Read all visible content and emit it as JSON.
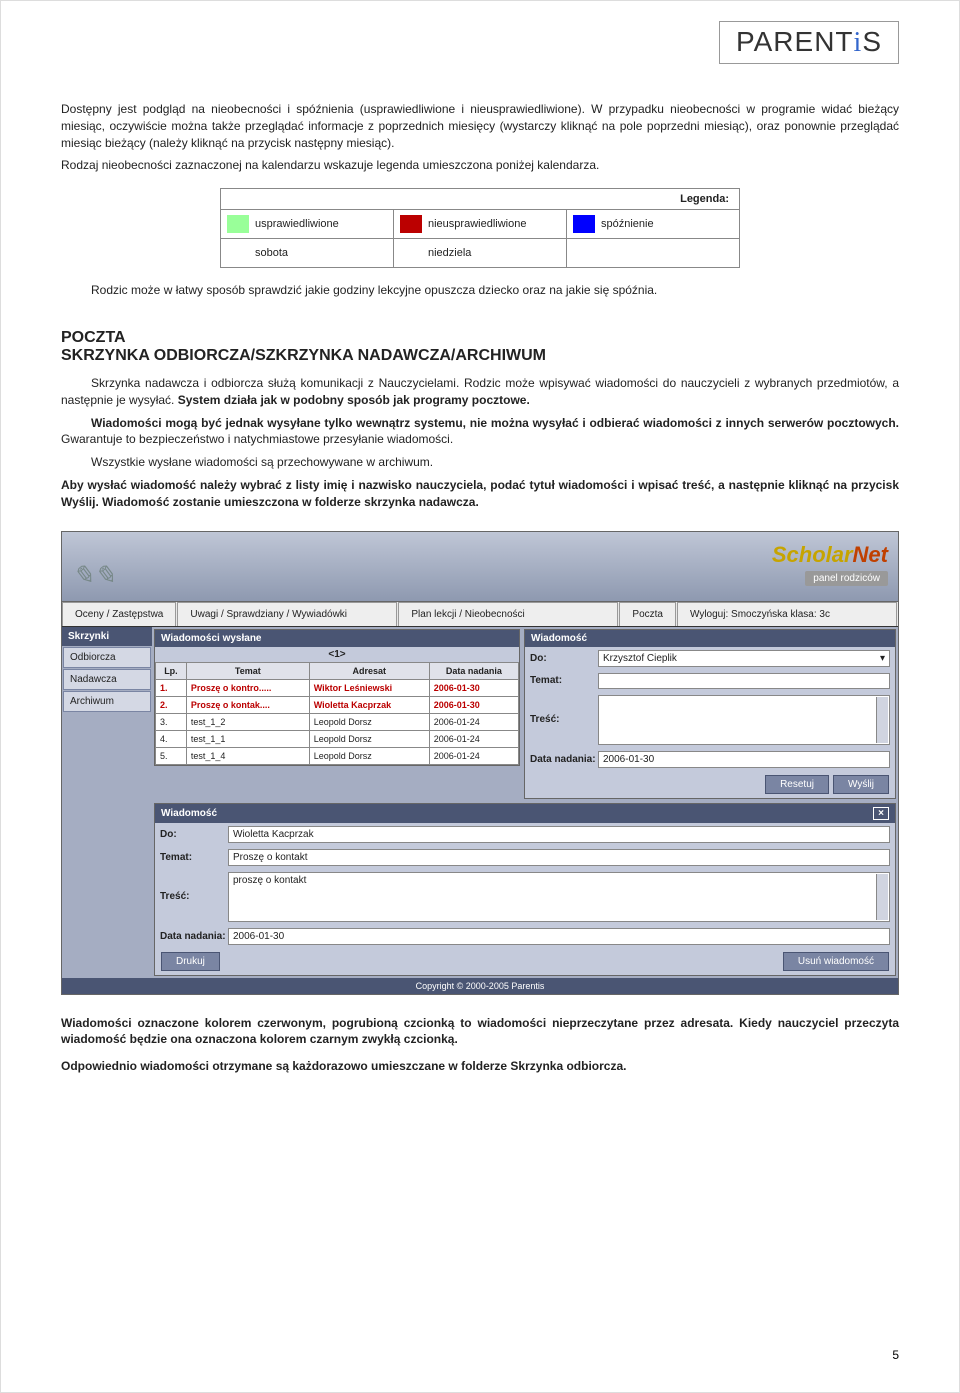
{
  "brand": "PARENTiS",
  "intro_p1": "Dostępny jest podgląd na nieobecności i spóźnienia (usprawiedliwione i nieusprawiedliwione). W przypadku nieobecności w programie widać bieżący miesiąc, oczywiście można także przeglądać informacje z poprzednich miesięcy (wystarczy kliknąć na pole poprzedni miesiąc), oraz ponownie przeglądać miesiąc bieżący (należy kliknąć na przycisk następny miesiąc).",
  "intro_p2": "Rodzaj nieobecności zaznaczonej na kalendarzu wskazuje legenda umieszczona poniżej kalendarza.",
  "legend": {
    "title": "Legenda:",
    "r1c1": "usprawiedliwione",
    "r1c2": "nieusprawiedliwione",
    "r1c3": "spóźnienie",
    "r2c1": "sobota",
    "r2c2": "niedziela"
  },
  "intro_p3": "Rodzic może w łatwy sposób sprawdzić jakie godziny lekcyjne opuszcza dziecko oraz na jakie się spóźnia.",
  "section_title": "POCZTA\nSKRZYNKA ODBIORCZA/SZKRZYNKA NADAWCZA/ARCHIWUM",
  "p4a": "Skrzynka nadawcza i odbiorcza służą komunikacji z Nauczycielami. Rodzic może wpisywać wiadomości do nauczycieli z wybranych przedmiotów, a następnie je wysyłać. ",
  "p4b": "System działa jak w podobny sposób jak programy pocztowe.",
  "p5a": "Wiadomości mogą być jednak wysyłane tylko wewnątrz systemu, nie można wysyłać i odbierać wiadomości z innych serwerów pocztowych.",
  "p5b": " Gwarantuje to bezpieczeństwo i natychmiastowe przesyłanie wiadomości.",
  "p6": "Wszystkie wysłane wiadomości są przechowywane w archiwum.",
  "p7": "Aby wysłać wiadomość należy wybrać z listy imię i nazwisko nauczyciela, podać tytuł wiadomości i wpisać treść, a następnie kliknąć na przycisk Wyślij. Wiadomość zostanie umieszczona w folderze skrzynka nadawcza.",
  "app": {
    "logo": "ScholarNet",
    "panel_tag": "panel rodziców",
    "tabs": {
      "t1": "Oceny / Zastępstwa",
      "t2": "Uwagi / Sprawdziany / Wywiadówki",
      "t3": "Plan lekcji / Nieobecności",
      "t4": "Poczta",
      "t5": "Wyloguj: Smoczyńska klasa: 3c"
    },
    "sidebar": {
      "head": "Skrzynki",
      "items": [
        "Odbiorcza",
        "Nadawcza",
        "Archiwum"
      ]
    },
    "sent_panel": {
      "title": "Wiadomości wysłane",
      "pager": "<1>",
      "cols": {
        "lp": "Lp.",
        "temat": "Temat",
        "adresat": "Adresat",
        "data": "Data nadania"
      },
      "rows": [
        {
          "lp": "1.",
          "temat": "Proszę o kontro.....",
          "adresat": "Wiktor Leśniewski",
          "data": "2006-01-30",
          "unread": true
        },
        {
          "lp": "2.",
          "temat": "Proszę o kontak....",
          "adresat": "Wioletta Kacprzak",
          "data": "2006-01-30",
          "unread": true
        },
        {
          "lp": "3.",
          "temat": "test_1_2",
          "adresat": "Leopold Dorsz",
          "data": "2006-01-24",
          "unread": false
        },
        {
          "lp": "4.",
          "temat": "test_1_1",
          "adresat": "Leopold Dorsz",
          "data": "2006-01-24",
          "unread": false
        },
        {
          "lp": "5.",
          "temat": "test_1_4",
          "adresat": "Leopold Dorsz",
          "data": "2006-01-24",
          "unread": false
        }
      ]
    },
    "compose": {
      "title": "Wiadomość",
      "do_label": "Do:",
      "do_value": "Krzysztof Cieplik",
      "temat_label": "Temat:",
      "tresc_label": "Treść:",
      "data_label": "Data nadania:",
      "data_value": "2006-01-30",
      "btn_reset": "Resetuj",
      "btn_send": "Wyślij"
    },
    "view": {
      "title": "Wiadomość",
      "close": "×",
      "do_label": "Do:",
      "do_value": "Wioletta Kacprzak",
      "temat_label": "Temat:",
      "temat_value": "Proszę o kontakt",
      "tresc_label": "Treść:",
      "tresc_value": "proszę o kontakt",
      "data_label": "Data nadania:",
      "data_value": "2006-01-30",
      "btn_print": "Drukuj",
      "btn_delete": "Usuń wiadomość"
    },
    "copyright": "Copyright © 2000-2005 Parentis"
  },
  "after1a": "Wiadomości oznaczone kolorem czerwonym, pogrubioną czcionką to wiadomości nieprzeczytane przez adresata.",
  "after1b": " Kiedy nauczyciel przeczyta wiadomość będzie ona oznaczona kolorem czarnym zwykłą czcionką.",
  "after2": "Odpowiednio wiadomości otrzymane są każdorazowo umieszczane w folderze Skrzynka odbiorcza.",
  "page_num": "5"
}
